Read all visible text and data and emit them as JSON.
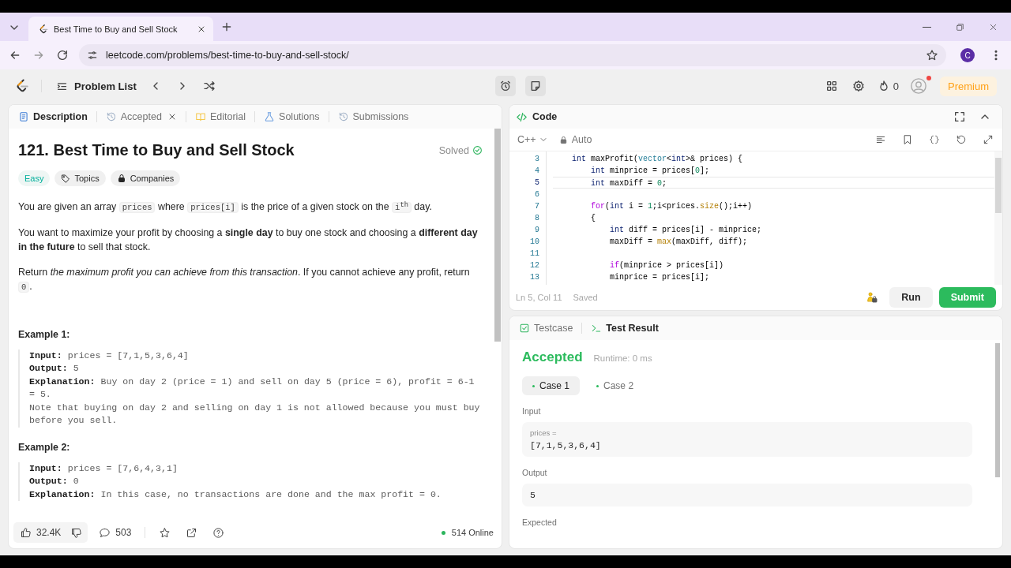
{
  "browser": {
    "tabs": [
      {
        "title": "Best Time to Buy and Sell Stock",
        "selected": true
      }
    ],
    "url": "leetcode.com/problems/best-time-to-buy-and-sell-stock/",
    "profile_initial": "C"
  },
  "nav": {
    "problem_list": "Problem List",
    "streak": "0",
    "premium": "Premium"
  },
  "description_tabs": [
    {
      "label": "Description",
      "selected": true,
      "closable": false
    },
    {
      "label": "Accepted",
      "selected": false,
      "closable": true
    },
    {
      "label": "Editorial",
      "selected": false,
      "closable": false
    },
    {
      "label": "Solutions",
      "selected": false,
      "closable": false
    },
    {
      "label": "Submissions",
      "selected": false,
      "closable": false
    }
  ],
  "problem": {
    "title": "121. Best Time to Buy and Sell Stock",
    "status": "Solved",
    "difficulty": "Easy",
    "tags": [
      "Topics",
      "Companies"
    ],
    "paragraphs": [
      [
        {
          "kind": "text",
          "text": "You are given an array "
        },
        {
          "kind": "code",
          "text": "prices"
        },
        {
          "kind": "text",
          "text": " where "
        },
        {
          "kind": "code",
          "text": "prices[i]"
        },
        {
          "kind": "text",
          "text": " is the price of a given stock on the "
        },
        {
          "kind": "code",
          "text": "i$^{th}$"
        },
        {
          "kind": "text",
          "text": " day."
        }
      ],
      [
        {
          "kind": "text",
          "text": "You want to maximize your profit by choosing a **single day** to buy one stock and choosing a **different day in the future** to sell that stock."
        }
      ],
      [
        {
          "kind": "text",
          "text": "Return *the maximum profit you can achieve from this transaction*. If you cannot achieve any profit, return "
        },
        {
          "kind": "code",
          "text": "0"
        },
        {
          "kind": "text",
          "text": "."
        }
      ]
    ],
    "examples": [
      {
        "title": "Example 1:",
        "lines": [
          {
            "label": "Input:",
            "value": "prices = [7,1,5,3,6,4]"
          },
          {
            "label": "Output:",
            "value": "5"
          },
          {
            "label": "Explanation:",
            "value": "Buy on day 2 (price = 1) and sell on day 5 (price = 6), profit = 6-1 = 5."
          },
          {
            "value": "Note that buying on day 2 and selling on day 1 is not allowed because you must buy before you sell."
          }
        ]
      },
      {
        "title": "Example 2:",
        "lines": [
          {
            "label": "Input:",
            "value": "prices = [7,6,4,3,1]"
          },
          {
            "label": "Output:",
            "value": "0"
          },
          {
            "label": "Explanation:",
            "value": "In this case, no transactions are done and the max profit = 0."
          }
        ]
      }
    ]
  },
  "footer": {
    "likes": "32.4K",
    "comments": "503",
    "online": "514 Online"
  },
  "code_panel": {
    "title": "Code",
    "language": "C++",
    "mode": "Auto",
    "lines": [
      {
        "number": "3",
        "current": false,
        "tokens": [
          {
            "kind": "kw",
            "text": "    int"
          },
          {
            "kind": "plain",
            "text": " maxProfit("
          },
          {
            "kind": "type",
            "text": "vector"
          },
          {
            "kind": "plain",
            "text": "<"
          },
          {
            "kind": "kw",
            "text": "int"
          },
          {
            "kind": "plain",
            "text": ">& prices) {"
          }
        ]
      },
      {
        "number": "4",
        "current": false,
        "tokens": [
          {
            "kind": "kw",
            "text": "        int"
          },
          {
            "kind": "plain",
            "text": " minprice = prices["
          },
          {
            "kind": "num",
            "text": "0"
          },
          {
            "kind": "plain",
            "text": "];"
          }
        ]
      },
      {
        "number": "5",
        "current": true,
        "tokens": [
          {
            "kind": "kw",
            "text": "        int"
          },
          {
            "kind": "plain",
            "text": " maxDiff = "
          },
          {
            "kind": "num",
            "text": "0"
          },
          {
            "kind": "plain",
            "text": ";"
          }
        ]
      },
      {
        "number": "6",
        "current": false
      },
      {
        "number": "7",
        "current": false,
        "tokens": [
          {
            "kind": "ctl",
            "text": "        for"
          },
          {
            "kind": "plain",
            "text": "("
          },
          {
            "kind": "kw",
            "text": "int"
          },
          {
            "kind": "plain",
            "text": " i = "
          },
          {
            "kind": "num",
            "text": "1"
          },
          {
            "kind": "plain",
            "text": ";i<prices."
          },
          {
            "kind": "fn",
            "text": "size"
          },
          {
            "kind": "plain",
            "text": "();i++)"
          }
        ]
      },
      {
        "number": "8",
        "current": false,
        "tokens": [
          {
            "kind": "plain",
            "text": "        {"
          }
        ]
      },
      {
        "number": "9",
        "current": false,
        "tokens": [
          {
            "kind": "kw",
            "text": "            int"
          },
          {
            "kind": "plain",
            "text": " diff = prices[i] - minprice;"
          }
        ]
      },
      {
        "number": "10",
        "current": false,
        "tokens": [
          {
            "kind": "plain",
            "text": "            maxDiff = "
          },
          {
            "kind": "fn",
            "text": "max"
          },
          {
            "kind": "plain",
            "text": "(maxDiff, diff);"
          }
        ]
      },
      {
        "number": "11",
        "current": false
      },
      {
        "number": "12",
        "current": false,
        "tokens": [
          {
            "kind": "ctl",
            "text": "            if"
          },
          {
            "kind": "plain",
            "text": "(minprice > prices[i])"
          }
        ]
      },
      {
        "number": "13",
        "current": false,
        "tokens": [
          {
            "kind": "plain",
            "text": "            minprice = prices[i];"
          }
        ]
      }
    ],
    "cursor": "Ln 5, Col 11",
    "save_state": "Saved",
    "buttons": [
      {
        "label": "Run",
        "kind": "secondary"
      },
      {
        "label": "Submit",
        "kind": "primary"
      }
    ]
  },
  "result_tabs": [
    {
      "label": "Testcase",
      "selected": false
    },
    {
      "label": "Test Result",
      "selected": true
    }
  ],
  "result": {
    "verdict": "Accepted",
    "runtime": "Runtime: 0 ms",
    "cases": [
      {
        "label": "Case 1",
        "selected": true,
        "passed": true
      },
      {
        "label": "Case 2",
        "selected": false,
        "passed": true
      }
    ],
    "sections": [
      {
        "label": "Input",
        "fields": [
          {
            "name": "prices =",
            "value": "[7,1,5,3,6,4]"
          }
        ]
      },
      {
        "label": "Output",
        "fields": [
          {
            "value": "5"
          }
        ]
      },
      {
        "label": "Expected"
      }
    ]
  }
}
